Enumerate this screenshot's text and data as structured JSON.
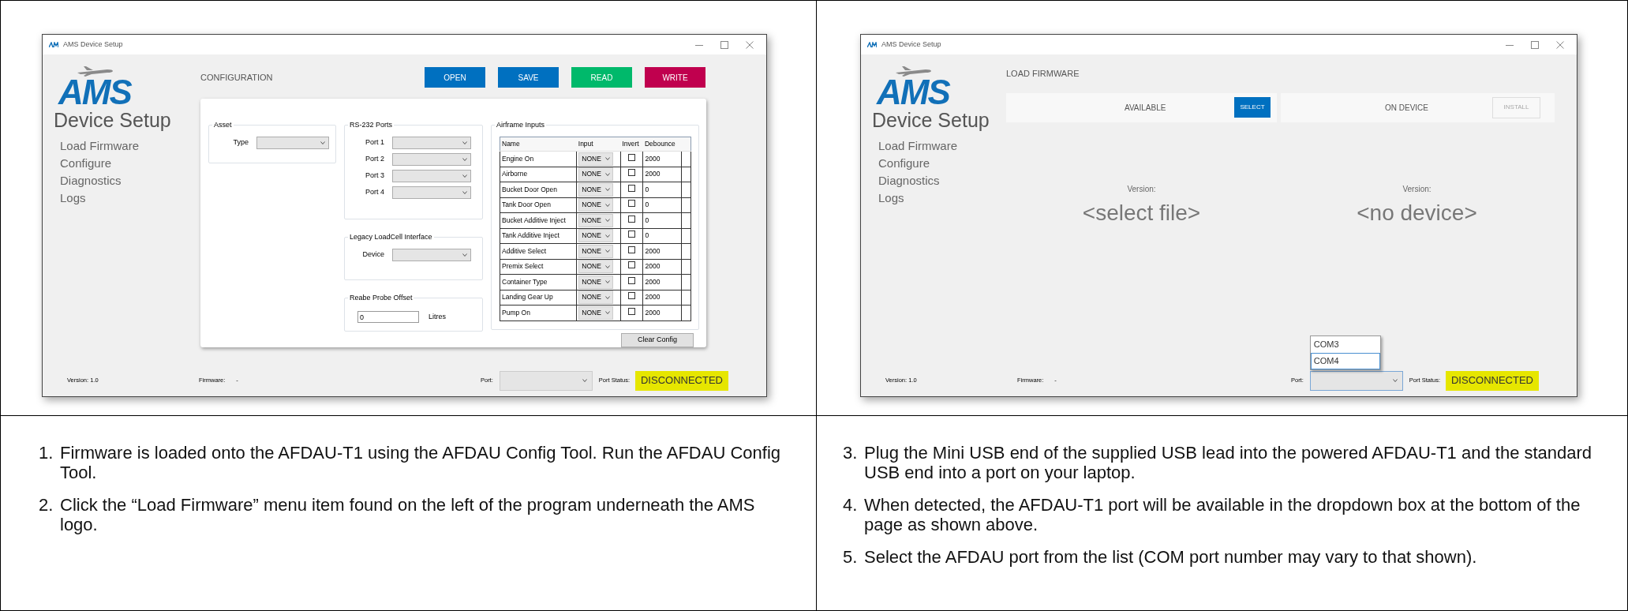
{
  "panels": [
    {
      "kind": "configuration",
      "window": {
        "title": "AMS Device Setup"
      },
      "logo": {
        "text": "AMS",
        "subtitle": "Device Setup"
      },
      "menu": [
        {
          "label": "Load Firmware"
        },
        {
          "label": "Configure"
        },
        {
          "label": "Diagnostics"
        },
        {
          "label": "Logs"
        }
      ],
      "page_title": "CONFIGURATION",
      "buttons": [
        {
          "label": "OPEN",
          "color": "#0070c0"
        },
        {
          "label": "SAVE",
          "color": "#0070c0"
        },
        {
          "label": "READ",
          "color": "#00b96b"
        },
        {
          "label": "WRITE",
          "color": "#c0004e"
        }
      ],
      "asset": {
        "title": "Asset",
        "fields": [
          {
            "label": "Type"
          }
        ]
      },
      "rs232": {
        "title": "RS-232 Ports",
        "fields": [
          {
            "label": "Port 1"
          },
          {
            "label": "Port 2"
          },
          {
            "label": "Port 3"
          },
          {
            "label": "Port 4"
          }
        ]
      },
      "legacy": {
        "title": "Legacy LoadCell Interface",
        "fields": [
          {
            "label": "Device"
          }
        ]
      },
      "probe": {
        "title": "Reabe Probe Offset",
        "value": "0",
        "unit": "Litres"
      },
      "airframe": {
        "title": "Airframe Inputs",
        "columns": [
          "Name",
          "Input",
          "Invert",
          "Debounce"
        ],
        "rows": [
          {
            "name": "Engine On",
            "input": "NONE",
            "invert": false,
            "debounce": "2000"
          },
          {
            "name": "Airborne",
            "input": "NONE",
            "invert": false,
            "debounce": "2000"
          },
          {
            "name": "Bucket Door Open",
            "input": "NONE",
            "invert": false,
            "debounce": "0"
          },
          {
            "name": "Tank Door Open",
            "input": "NONE",
            "invert": false,
            "debounce": "0"
          },
          {
            "name": "Bucket Additive Inject",
            "input": "NONE",
            "invert": false,
            "debounce": "0"
          },
          {
            "name": "Tank Additive Inject",
            "input": "NONE",
            "invert": false,
            "debounce": "0"
          },
          {
            "name": "Additive Select",
            "input": "NONE",
            "invert": false,
            "debounce": "2000"
          },
          {
            "name": "Premix Select",
            "input": "NONE",
            "invert": false,
            "debounce": "2000"
          },
          {
            "name": "Container Type",
            "input": "NONE",
            "invert": false,
            "debounce": "2000"
          },
          {
            "name": "Landing Gear Up",
            "input": "NONE",
            "invert": false,
            "debounce": "2000"
          },
          {
            "name": "Pump On",
            "input": "NONE",
            "invert": false,
            "debounce": "2000"
          }
        ]
      },
      "clear_button": "Clear Config",
      "status_bar": {
        "version": "Version: 1.0",
        "firmware_label": "Firmware:",
        "firmware": "-",
        "port_label": "Port:",
        "port_dropdown": {
          "expanded": false
        },
        "port_status_label": "Port Status:",
        "port_status": "DISCONNECTED",
        "connected": false
      }
    },
    {
      "kind": "load_firmware",
      "window": {
        "title": "AMS Device Setup"
      },
      "logo": {
        "text": "AMS",
        "subtitle": "Device Setup"
      },
      "menu": [
        {
          "label": "Load Firmware"
        },
        {
          "label": "Configure"
        },
        {
          "label": "Diagnostics"
        },
        {
          "label": "Logs"
        }
      ],
      "page_title": "LOAD FIRMWARE",
      "available": {
        "label": "AVAILABLE",
        "button": "SELECT",
        "version_label": "Version:",
        "version": "<select file>"
      },
      "on_device": {
        "label": "ON DEVICE",
        "button": "INSTALL",
        "disabled": true,
        "version_label": "Version:",
        "version": "<no device>"
      },
      "status_bar": {
        "version": "Version: 1.0",
        "firmware_label": "Firmware:",
        "firmware": "-",
        "port_label": "Port:",
        "port_dropdown": {
          "expanded": true,
          "options": [
            {
              "label": "COM3",
              "selected": false
            },
            {
              "label": "COM4",
              "selected": true
            }
          ]
        },
        "port_status_label": "Port Status:",
        "port_status": "DISCONNECTED",
        "connected": false
      }
    }
  ],
  "steps": [
    [
      {
        "number": "1.",
        "text": "Firmware is loaded onto the AFDAU-T1 using the AFDAU Config Tool. Run the AFDAU Config Tool."
      },
      {
        "number": "2.",
        "text": "Click the “Load Firmware” menu item found on the left of the program underneath the AMS logo."
      }
    ],
    [
      {
        "number": "3.",
        "text": "Plug the Mini USB end of the supplied USB lead into the powered AFDAU-T1 and the standard USB end into a port on your laptop."
      },
      {
        "number": "4.",
        "text": "When detected, the AFDAU-T1 port will be available in the dropdown box at the bottom of the page as shown above."
      },
      {
        "number": "5.",
        "text": "Select the AFDAU port from the list (COM port number may vary to that shown)."
      }
    ]
  ]
}
